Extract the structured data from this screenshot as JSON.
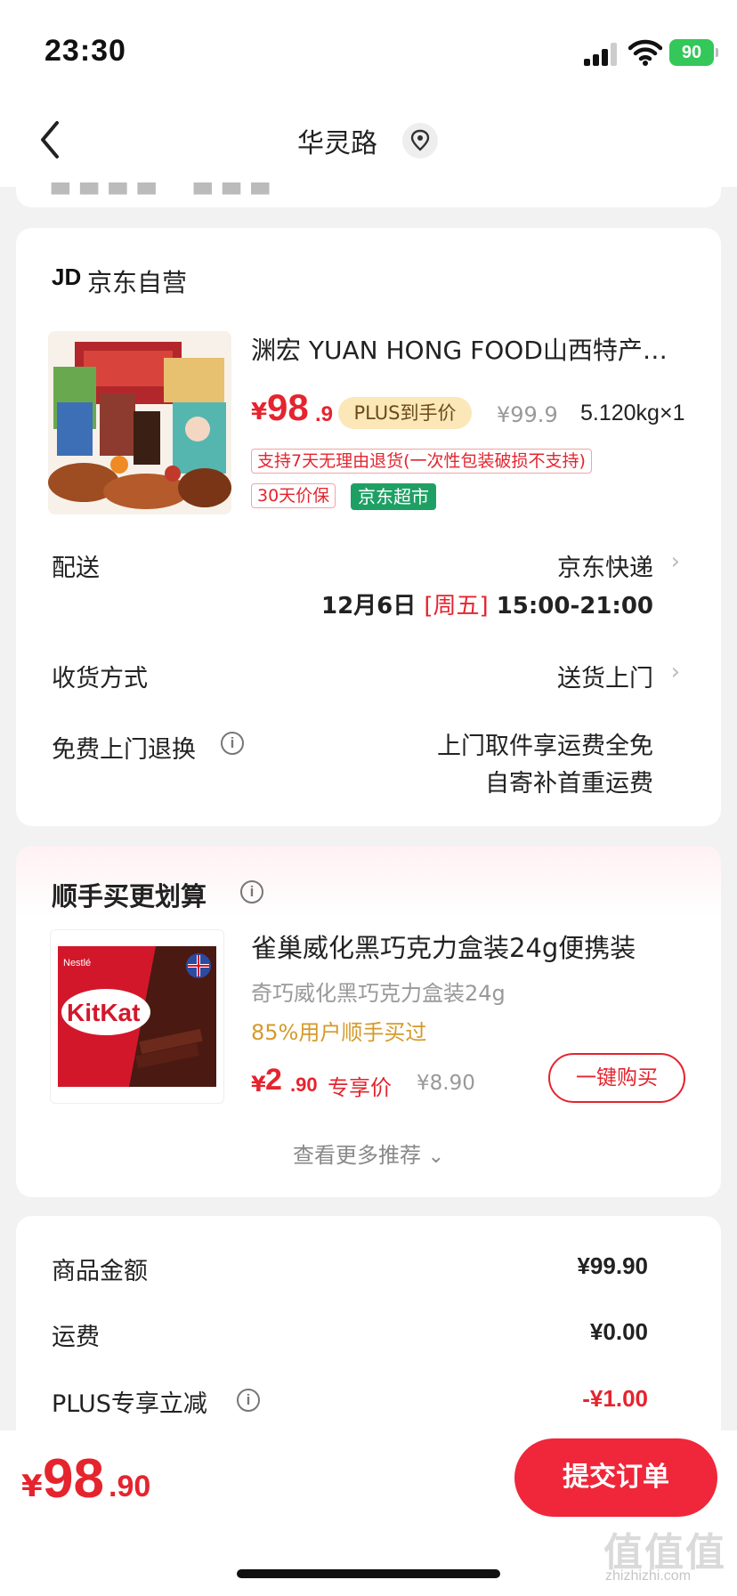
{
  "status_bar": {
    "time": "23:30",
    "battery": "90"
  },
  "header": {
    "title": "华灵路"
  },
  "shop": {
    "logo": "JD",
    "name": "京东自营"
  },
  "product": {
    "title": "渊宏 YUAN HONG FOOD山西特产…",
    "price_symbol": "¥",
    "price_int": "98",
    "price_dec": ".9",
    "plus_badge": "PLUS到手价",
    "original_price": "¥99.9",
    "weight_qty": "5.120kg×1",
    "tag_return": "支持7天无理由退货(一次性包装破损不支持)",
    "tag_price_protect": "30天价保",
    "tag_supermarket": "京东超市"
  },
  "delivery": {
    "label": "配送",
    "carrier": "京东快递",
    "date": "12月6日",
    "weekday": "[周五]",
    "time_range": "15:00-21:00"
  },
  "receive": {
    "label": "收货方式",
    "value": "送货上门"
  },
  "free_return": {
    "label": "免费上门退换",
    "line1": "上门取件享运费全免",
    "line2": "自寄补首重运费"
  },
  "addon": {
    "title": "顺手买更划算",
    "name": "雀巢威化黑巧克力盒装24g便携装",
    "subtitle": "奇巧威化黑巧克力盒装24g",
    "popularity": "85%用户顺手买过",
    "price_symbol": "¥",
    "price_int": "2",
    "price_dec": ".90",
    "exclusive": "专享价",
    "original_price": "¥8.90",
    "buy_button": "一键购买",
    "more": "查看更多推荐",
    "image_brand": "KitKat",
    "image_maker": "Nestlé"
  },
  "summary": {
    "items": [
      {
        "label": "商品金额",
        "value": "¥99.90"
      },
      {
        "label": "运费",
        "value": "¥0.00"
      },
      {
        "label": "PLUS专享立减",
        "value": "-¥1.00"
      }
    ]
  },
  "footer": {
    "total_symbol": "¥",
    "total_int": "98",
    "total_dec": ".90",
    "submit": "提交订单"
  },
  "watermark": {
    "main": "值值值",
    "sub": "zhizhizhi.com"
  },
  "colors": {
    "accent": "#e5242e",
    "submit": "#f0263a",
    "supermarket": "#1ea064",
    "plus": "#fbe7b8"
  }
}
